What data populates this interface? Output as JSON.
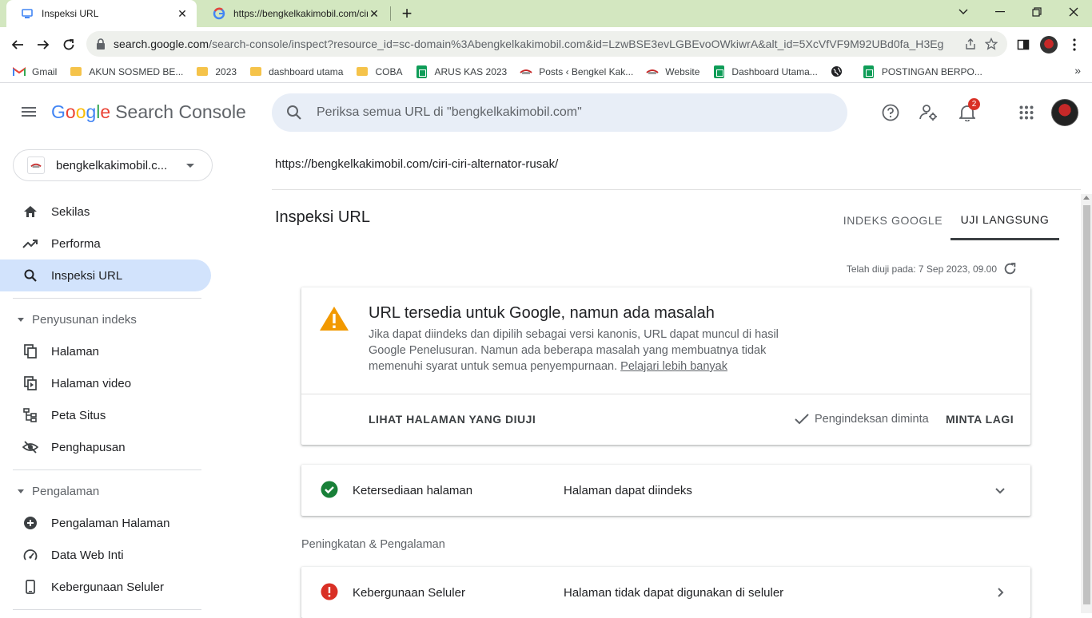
{
  "browser": {
    "tabs": [
      {
        "title": "Inspeksi URL",
        "active": true
      },
      {
        "title": "https://bengkelkakimobil.com/ciri-",
        "active": false
      }
    ],
    "url_host": "search.google.com",
    "url_rest": "/search-console/inspect?resource_id=sc-domain%3Abengkelkakimobil.com&id=LzwBSE3evLGBEvoOWkiwrA&alt_id=5XcVfVF9M92UBd0fa_H3Eg",
    "bookmarks": [
      {
        "label": "Gmail",
        "icon": "gmail-icon"
      },
      {
        "label": "AKUN SOSMED BE...",
        "icon": "folder-icon"
      },
      {
        "label": "2023",
        "icon": "folder-icon"
      },
      {
        "label": "dashboard utama",
        "icon": "folder-icon"
      },
      {
        "label": "COBA",
        "icon": "folder-icon"
      },
      {
        "label": "ARUS KAS 2023",
        "icon": "sheets-icon"
      },
      {
        "label": "Posts ‹ Bengkel Kak...",
        "icon": "site-icon"
      },
      {
        "label": "Website",
        "icon": "site-icon"
      },
      {
        "label": "Dashboard Utama...",
        "icon": "sheets-icon"
      },
      {
        "label": "",
        "icon": "globe-icon"
      },
      {
        "label": "POSTINGAN BERPO...",
        "icon": "sheets-icon"
      }
    ]
  },
  "header": {
    "logo_google": [
      "G",
      "o",
      "o",
      "g",
      "l",
      "e"
    ],
    "logo_product": "Search Console",
    "search_placeholder": "Periksa semua URL di \"bengkelkakimobil.com\"",
    "notifications_count": "2"
  },
  "sidebar": {
    "property": "bengkelkakimobil.c...",
    "items": [
      {
        "label": "Sekilas",
        "icon": "home-icon"
      },
      {
        "label": "Performa",
        "icon": "trending-up-icon"
      },
      {
        "label": "Inspeksi URL",
        "icon": "search-icon",
        "active": true
      }
    ],
    "section_index": "Penyusunan indeks",
    "index_items": [
      {
        "label": "Halaman",
        "icon": "pages-icon"
      },
      {
        "label": "Halaman video",
        "icon": "video-page-icon"
      },
      {
        "label": "Peta Situs",
        "icon": "sitemap-icon"
      },
      {
        "label": "Penghapusan",
        "icon": "removal-icon"
      }
    ],
    "section_experience": "Pengalaman",
    "experience_items": [
      {
        "label": "Pengalaman Halaman",
        "icon": "add-circle-icon"
      },
      {
        "label": "Data Web Inti",
        "icon": "speedometer-icon"
      },
      {
        "label": "Kebergunaan Seluler",
        "icon": "phone-icon"
      }
    ]
  },
  "main": {
    "inspected_url": "https://bengkelkakimobil.com/ciri-ciri-alternator-rusak/",
    "title": "Inspeksi URL",
    "tabs": [
      "INDEKS GOOGLE",
      "UJI LANGSUNG"
    ],
    "tested_on": "Telah diuji pada: 7 Sep 2023, 09.00",
    "status": {
      "heading": "URL tersedia untuk Google, namun ada masalah",
      "description": "Jika dapat diindeks dan dipilih sebagai versi kanonis, URL dapat muncul di hasil Google Penelusuran. Namun ada beberapa masalah yang membuatnya tidak memenuhi syarat untuk semua penyempurnaan.",
      "learn_more": "Pelajari lebih banyak",
      "view_tested": "LIHAT HALAMAN YANG DIUJI",
      "indexing_requested": "Pengindeksan diminta",
      "request_again": "MINTA LAGI"
    },
    "availability": {
      "label": "Ketersediaan halaman",
      "value": "Halaman dapat diindeks"
    },
    "section_label": "Peningkatan & Pengalaman",
    "mobile": {
      "label": "Kebergunaan Seluler",
      "value": "Halaman tidak dapat digunakan di seluler"
    }
  },
  "colors": {
    "accent_active_nav": "#d2e3fc",
    "warning": "#f29900",
    "success": "#188038",
    "error": "#d93025",
    "tabstrip": "#d3e7c0"
  }
}
